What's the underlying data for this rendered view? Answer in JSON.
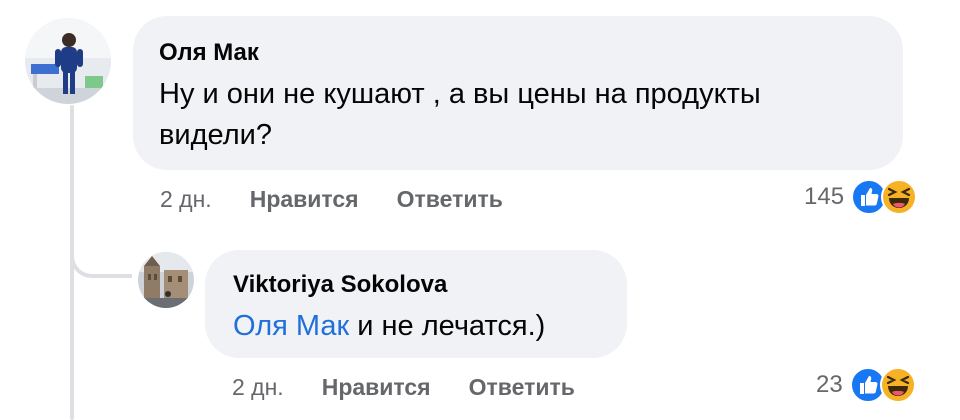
{
  "comment": {
    "author": "Оля Мак",
    "text": "Ну и они не кушают , а вы цены на продукты видели?",
    "time": "2 дн.",
    "like_label": "Нравится",
    "reply_label": "Ответить",
    "reactions_count": "145",
    "reaction_icons": [
      "like-icon",
      "haha-icon"
    ]
  },
  "reply": {
    "author": "Viktoriya Sokolova",
    "mention": "Оля Мак",
    "text": " и не лечатся.)",
    "time": "2 дн.",
    "like_label": "Нравится",
    "reply_label": "Ответить",
    "reactions_count": "23",
    "reaction_icons": [
      "like-icon",
      "haha-icon"
    ]
  },
  "colors": {
    "bubble": "#f0f2f5",
    "mention": "#216fdb",
    "meta": "#65676b",
    "like": "#1877f2",
    "haha": "#f7b125"
  }
}
